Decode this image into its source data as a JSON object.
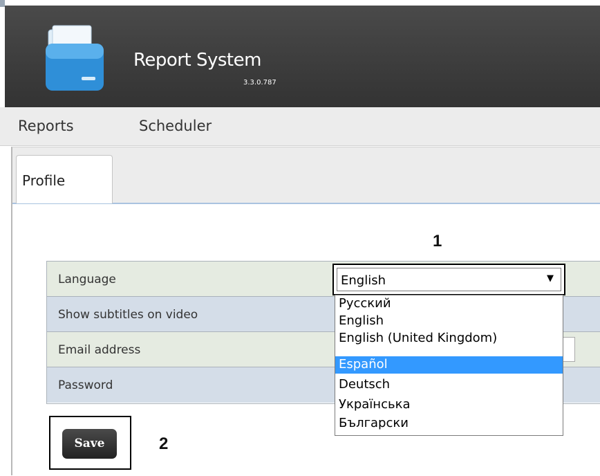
{
  "header": {
    "app_title": "Report System",
    "app_version": "3.3.0.787",
    "logo_icon": "folder-icon"
  },
  "nav": {
    "items": [
      {
        "label": "Reports"
      },
      {
        "label": "Scheduler"
      }
    ]
  },
  "tabs": [
    {
      "label": "Profile",
      "active": true
    }
  ],
  "annotations": {
    "marker_1": "1",
    "marker_2": "2"
  },
  "profile": {
    "rows": [
      {
        "label": "Language"
      },
      {
        "label": "Show subtitles on video"
      },
      {
        "label": "Email address"
      },
      {
        "label": "Password"
      }
    ],
    "language_select": {
      "selected_value": "English",
      "arrow_icon": "triangle-down-icon",
      "options": [
        "Русский",
        "English",
        "English (United Kingdom)",
        "Español",
        "Deutsch",
        "Українська",
        "Български"
      ],
      "highlighted_option": "Español"
    },
    "save_label": "Save"
  },
  "colors": {
    "header_bg": "#3a3a3a",
    "navbar_bg": "#ececec",
    "row_green": "#e5ebe1",
    "row_blue": "#d4dde8",
    "option_highlight": "#3399ff",
    "logo_blue": "#2f8fd8"
  }
}
